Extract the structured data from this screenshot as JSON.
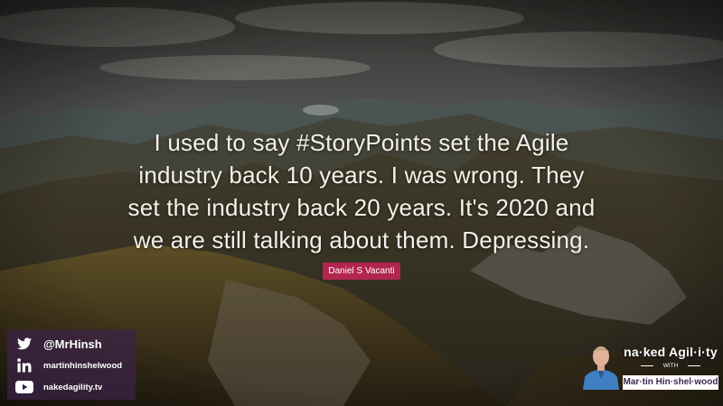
{
  "quote": {
    "lines": [
      "I used to say #StoryPoints set the Agile",
      "industry back 10 years. I was wrong. They",
      "set the industry back 20 years. It's 2020 and",
      "we are still talking about them. Depressing."
    ],
    "author": "Daniel S Vacanti"
  },
  "social": {
    "twitter": {
      "icon": "twitter-icon",
      "label": "@MrHinsh"
    },
    "linkedin": {
      "icon": "linkedin-icon",
      "label": "martinhinshelwood"
    },
    "youtube": {
      "icon": "youtube-icon",
      "label": "nakedagility.tv"
    }
  },
  "brand": {
    "title": "na·ked Agil·i·ty",
    "with": "WITH",
    "name": "Mar·tin Hin·shel·wood"
  },
  "colors": {
    "author_badge": "#b1264f",
    "social_panel": "#3c2248",
    "brand_name_text": "#3c2a55"
  }
}
